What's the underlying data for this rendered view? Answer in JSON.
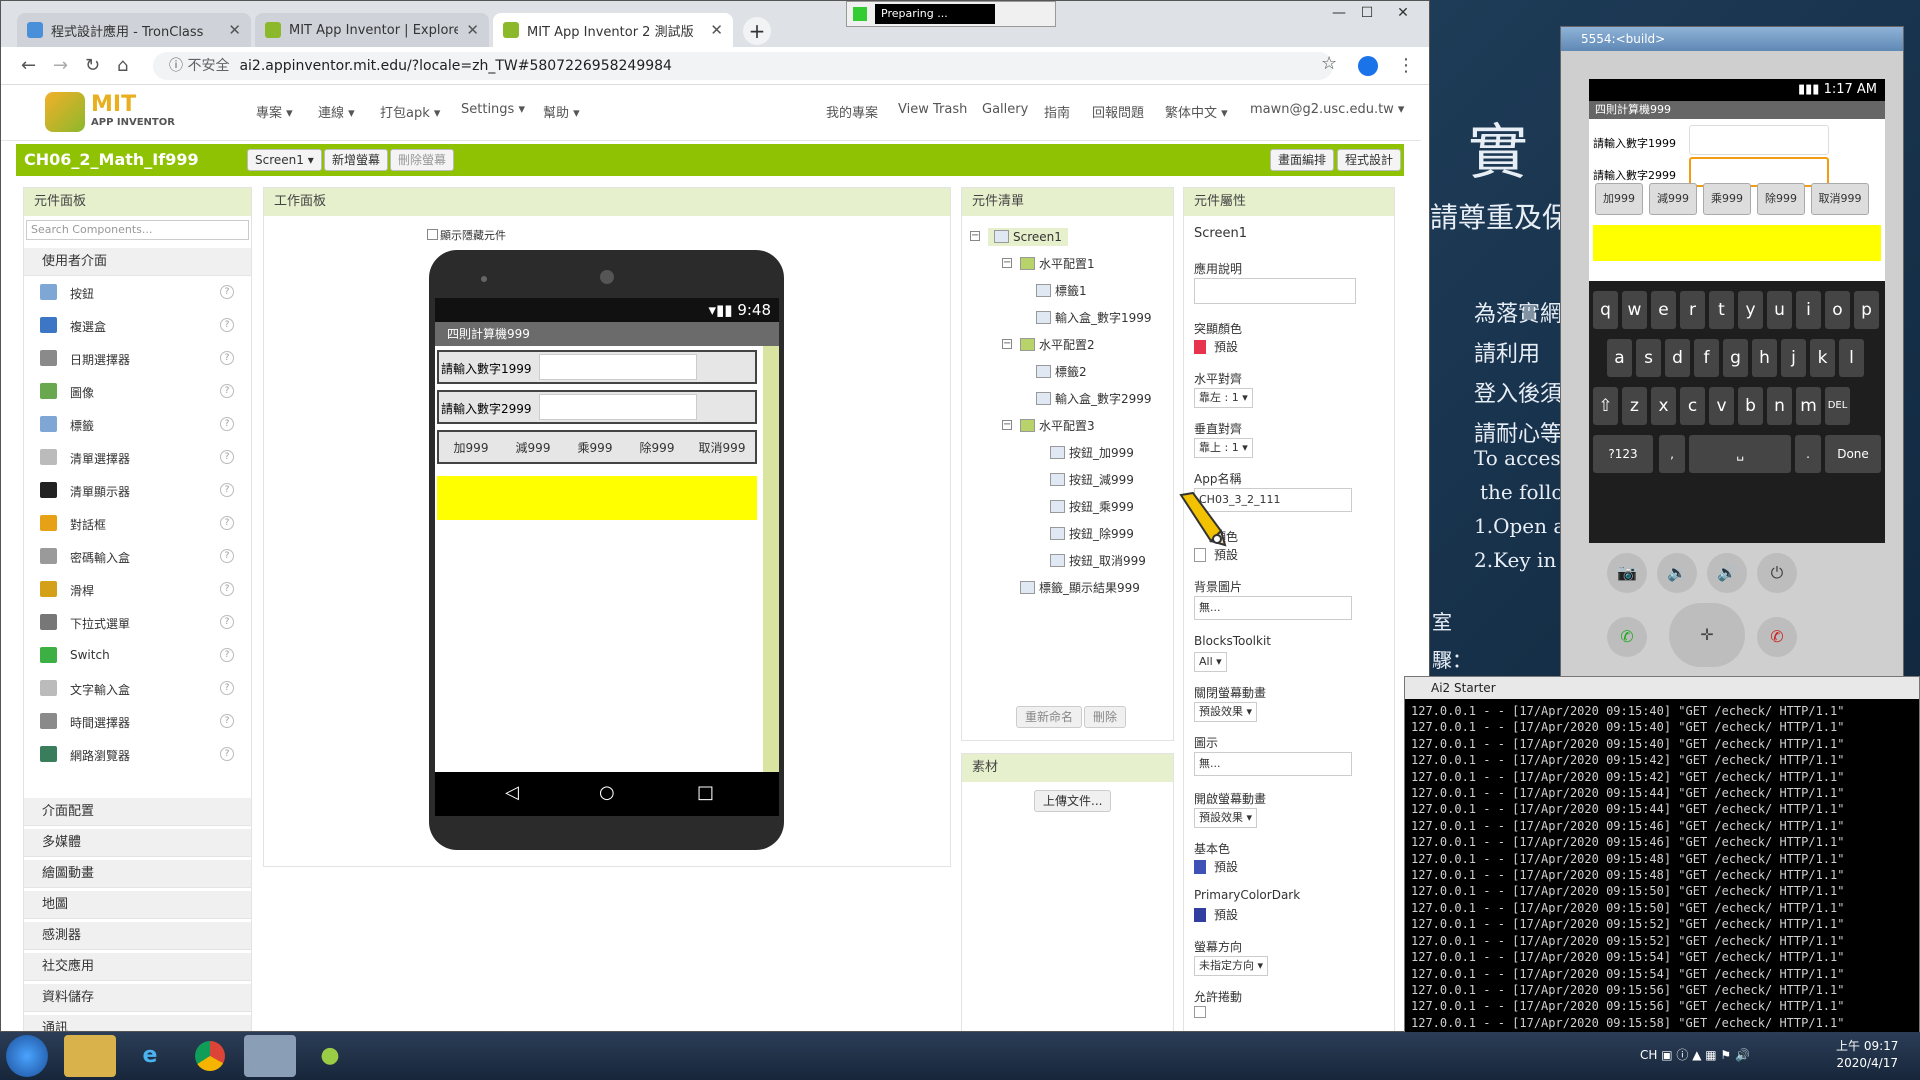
{
  "browser": {
    "tabs": [
      {
        "label": "程式設計應用 - TronClass",
        "icon_color": "#4a90d9"
      },
      {
        "label": "MIT App Inventor | Explore MI",
        "icon_color": "#8cb82b"
      },
      {
        "label": "MIT App Inventor 2 測試版",
        "icon_color": "#8cb82b"
      }
    ],
    "preparing": "Preparing ...",
    "not_secure": "不安全",
    "url": "ai2.appinventor.mit.edu/?locale=zh_TW#5807226958249984"
  },
  "header": {
    "logo_main": "MIT",
    "logo_sub": "APP INVENTOR",
    "menu_left": [
      "專案 ▾",
      "連線 ▾",
      "打包apk ▾",
      "Settings ▾",
      "幫助 ▾"
    ],
    "menu_right": [
      "我的專案",
      "View Trash",
      "Gallery",
      "指南",
      "回報問題",
      "繁体中文 ▾",
      "mawn@g2.usc.edu.tw ▾"
    ]
  },
  "toolbar": {
    "project": "CH06_2_Math_If999",
    "screen_select": "Screen1 ▾",
    "add_screen": "新增螢幕",
    "remove_screen": "刪除螢幕",
    "designer": "畫面編排",
    "blocks": "程式設計",
    "accent": "#8fc202"
  },
  "palette": {
    "title": "元件面板",
    "search_placeholder": "Search Components...",
    "ui_category": "使用者介面",
    "components": [
      {
        "label": "按鈕",
        "icon_color": "#7fa7d6"
      },
      {
        "label": "複選盒",
        "icon_color": "#3c76c4"
      },
      {
        "label": "日期選擇器",
        "icon_color": "#8a8a8a"
      },
      {
        "label": "圖像",
        "icon_color": "#6aa84f"
      },
      {
        "label": "標籤",
        "icon_color": "#7fa7d6"
      },
      {
        "label": "清單選擇器",
        "icon_color": "#bbbbbb"
      },
      {
        "label": "清單顯示器",
        "icon_color": "#222222"
      },
      {
        "label": "對話框",
        "icon_color": "#e6a117"
      },
      {
        "label": "密碼輸入盒",
        "icon_color": "#9a9a9a"
      },
      {
        "label": "滑桿",
        "icon_color": "#d4a017"
      },
      {
        "label": "下拉式選單",
        "icon_color": "#777777"
      },
      {
        "label": "Switch",
        "icon_color": "#3cb043"
      },
      {
        "label": "文字輸入盒",
        "icon_color": "#bbbbbb"
      },
      {
        "label": "時間選擇器",
        "icon_color": "#8a8a8a"
      },
      {
        "label": "網路瀏覽器",
        "icon_color": "#3a7d5c"
      }
    ],
    "categories": [
      "介面配置",
      "多媒體",
      "繪圖動畫",
      "地圖",
      "感測器",
      "社交應用",
      "資料儲存",
      "通訊"
    ]
  },
  "viewer": {
    "title": "工作面板",
    "show_hidden": "顯示隱藏元件",
    "status_time": "9:48",
    "app_title": "四則計算機999",
    "label1": "請輸入數字1999",
    "label2": "請輸入數字2999",
    "buttons": [
      "加999",
      "減999",
      "乘999",
      "除999",
      "取消999"
    ],
    "result_color": "#ffff00"
  },
  "tree": {
    "title": "元件清單",
    "items": [
      {
        "label": "Screen1",
        "depth": 0,
        "toggle": "⊟",
        "selected": true
      },
      {
        "label": "水平配置1",
        "depth": 1,
        "toggle": "⊟"
      },
      {
        "label": "標籤1",
        "depth": 2
      },
      {
        "label": "輸入盒_數字1999",
        "depth": 2
      },
      {
        "label": "水平配置2",
        "depth": 1,
        "toggle": "⊟"
      },
      {
        "label": "標籤2",
        "depth": 2
      },
      {
        "label": "輸入盒_數字2999",
        "depth": 2
      },
      {
        "label": "水平配置3",
        "depth": 1,
        "toggle": "⊟"
      },
      {
        "label": "按鈕_加999",
        "depth": 3
      },
      {
        "label": "按鈕_減999",
        "depth": 3
      },
      {
        "label": "按鈕_乘999",
        "depth": 3
      },
      {
        "label": "按鈕_除999",
        "depth": 3
      },
      {
        "label": "按鈕_取消999",
        "depth": 3
      },
      {
        "label": "標籤_顯示結果999",
        "depth": 1
      }
    ],
    "rename": "重新命名",
    "delete": "刪除"
  },
  "media": {
    "title": "素材",
    "upload": "上傳文件..."
  },
  "props": {
    "title": "元件屬性",
    "component": "Screen1",
    "about_label": "應用說明",
    "accent_label": "突顯顏色",
    "accent_value": "預設",
    "accent_color": "#e8334f",
    "halign_label": "水平對齊",
    "halign_value": "靠左 : 1 ▾",
    "valign_label": "垂直對齊",
    "valign_value": "靠上 : 1 ▾",
    "appname_label": "App名稱",
    "appname_value": "CH03_3_2_111",
    "bgcolor_label": "顏色",
    "bgcolor_value": "預設",
    "bgimage_label": "背景圖片",
    "bgimage_value": "無...",
    "toolkit_label": "BlocksToolkit",
    "toolkit_value": "All ▾",
    "close_anim_label": "關閉螢幕動畫",
    "close_anim_value": "預設效果 ▾",
    "icon_label": "圖示",
    "icon_value": "無...",
    "open_anim_label": "開啟螢幕動畫",
    "open_anim_value": "預設效果 ▾",
    "primary_label": "基本色",
    "primary_value": "預設",
    "primary_color": "#3f51b5",
    "primary_dark_label": "PrimaryColorDark",
    "primary_dark_value": "預設",
    "primary_dark_color": "#303f9f",
    "orientation_label": "螢幕方向",
    "orientation_value": "未指定方向 ▾",
    "scroll_label": "允許捲動"
  },
  "emulator": {
    "title": "5554:<build>",
    "time": "1:17 AM",
    "app_title": "四則計算機999",
    "label1": "請輸入數字1999",
    "label2": "請輸入數字2999",
    "buttons": [
      "加999",
      "減999",
      "乘999",
      "除999",
      "取消999"
    ],
    "keys_row1": [
      "q",
      "w",
      "e",
      "r",
      "t",
      "y",
      "u",
      "i",
      "o",
      "p"
    ],
    "keys_row2": [
      "a",
      "s",
      "d",
      "f",
      "g",
      "h",
      "j",
      "k",
      "l"
    ],
    "keys_row3": [
      "⇧",
      "z",
      "x",
      "c",
      "v",
      "b",
      "n",
      "m",
      "DEL"
    ],
    "keys_row4": [
      "?123",
      ",",
      "␣",
      ".",
      "Done"
    ]
  },
  "log": {
    "title": "Ai2 Starter",
    "lines": [
      "127.0.0.1 - - [17/Apr/2020 09:15:40] \"GET /echeck/ HTTP/1.1\"",
      "127.0.0.1 - - [17/Apr/2020 09:15:40] \"GET /echeck/ HTTP/1.1\"",
      "127.0.0.1 - - [17/Apr/2020 09:15:40] \"GET /echeck/ HTTP/1.1\"",
      "127.0.0.1 - - [17/Apr/2020 09:15:42] \"GET /echeck/ HTTP/1.1\"",
      "127.0.0.1 - - [17/Apr/2020 09:15:42] \"GET /echeck/ HTTP/1.1\"",
      "127.0.0.1 - - [17/Apr/2020 09:15:44] \"GET /echeck/ HTTP/1.1\"",
      "127.0.0.1 - - [17/Apr/2020 09:15:44] \"GET /echeck/ HTTP/1.1\"",
      "127.0.0.1 - - [17/Apr/2020 09:15:46] \"GET /echeck/ HTTP/1.1\"",
      "127.0.0.1 - - [17/Apr/2020 09:15:46] \"GET /echeck/ HTTP/1.1\"",
      "127.0.0.1 - - [17/Apr/2020 09:15:48] \"GET /echeck/ HTTP/1.1\"",
      "127.0.0.1 - - [17/Apr/2020 09:15:48] \"GET /echeck/ HTTP/1.1\"",
      "127.0.0.1 - - [17/Apr/2020 09:15:50] \"GET /echeck/ HTTP/1.1\"",
      "127.0.0.1 - - [17/Apr/2020 09:15:50] \"GET /echeck/ HTTP/1.1\"",
      "127.0.0.1 - - [17/Apr/2020 09:15:52] \"GET /echeck/ HTTP/1.1\"",
      "127.0.0.1 - - [17/Apr/2020 09:15:52] \"GET /echeck/ HTTP/1.1\"",
      "127.0.0.1 - - [17/Apr/2020 09:15:54] \"GET /echeck/ HTTP/1.1\"",
      "127.0.0.1 - - [17/Apr/2020 09:15:54] \"GET /echeck/ HTTP/1.1\"",
      "127.0.0.1 - - [17/Apr/2020 09:15:56] \"GET /echeck/ HTTP/1.1\"",
      "127.0.0.1 - - [17/Apr/2020 09:15:56] \"GET /echeck/ HTTP/1.1\"",
      "127.0.0.1 - - [17/Apr/2020 09:15:58] \"GET /echeck/ HTTP/1.1\""
    ]
  },
  "desktop": {
    "big_char": "實",
    "line1": "請尊重及保",
    "line2": "為落實網",
    "line3": "請利用",
    "line4": "登入後須",
    "line5": "請耐心等",
    "line6": "To access",
    "line7": "the follo",
    "line8": "1.Open a",
    "line9": "2.Key in s",
    "line10": "室",
    "line11": "驟："
  },
  "taskbar": {
    "lang": "CH",
    "time": "上午 09:17",
    "date": "2020/4/17"
  }
}
